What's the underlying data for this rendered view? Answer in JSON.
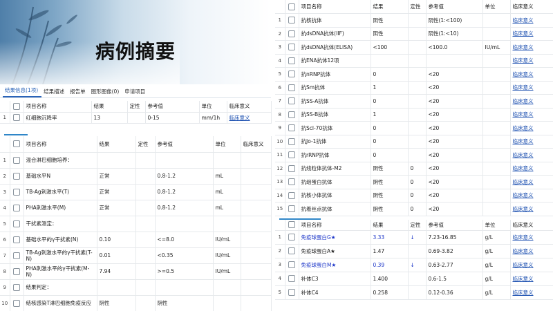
{
  "banner": {
    "title": "病例摘要"
  },
  "tabs": [
    "结果信息(1项)",
    "结果描述",
    "报告单",
    "图形图像(0)",
    "申请项目"
  ],
  "table1": {
    "headers": [
      "项目名称",
      "结果",
      "定性",
      "参考值",
      "单位",
      "临床意义"
    ],
    "rows": [
      {
        "num": "1",
        "name": "红细胞沉降率",
        "result": "13",
        "qual": "",
        "ref": "0-15",
        "unit": "mm/1h",
        "meaning": "临床意义"
      }
    ]
  },
  "table2": {
    "headers": [
      "项目名称",
      "结果",
      "定性",
      "参考值",
      "单位",
      "临床意义"
    ],
    "rows": [
      {
        "num": "1",
        "name": "混合淋巴细胞培养：",
        "result": "",
        "qual": "",
        "ref": "",
        "unit": "",
        "meaning": ""
      },
      {
        "num": "2",
        "name": "基础水平N",
        "result": "正常",
        "qual": "",
        "ref": "0.8-1.2",
        "unit": "mL",
        "meaning": ""
      },
      {
        "num": "3",
        "name": "TB-Ag刺激水平(T)",
        "result": "正常",
        "qual": "",
        "ref": "0.8-1.2",
        "unit": "mL",
        "meaning": ""
      },
      {
        "num": "4",
        "name": "PHA刺激水平(M)",
        "result": "正常",
        "qual": "",
        "ref": "0.8-1.2",
        "unit": "mL",
        "meaning": ""
      },
      {
        "num": "5",
        "name": "干扰素测定：",
        "result": "",
        "qual": "",
        "ref": "",
        "unit": "",
        "meaning": ""
      },
      {
        "num": "6",
        "name": "基础水平的γ干扰素(N)",
        "result": "0.10",
        "qual": "",
        "ref": "<=8.0",
        "unit": "IU/mL",
        "meaning": ""
      },
      {
        "num": "7",
        "name": "TB-Ag刺激水平的γ干扰素(T-N)",
        "result": "0.01",
        "qual": "",
        "ref": "<0.35",
        "unit": "IU/mL",
        "meaning": ""
      },
      {
        "num": "8",
        "name": "PHA刺激水平的γ干扰素(M-N)",
        "result": "7.94",
        "qual": "",
        "ref": ">=0.5",
        "unit": "IU/mL",
        "meaning": ""
      },
      {
        "num": "9",
        "name": "结果判定：",
        "result": "",
        "qual": "",
        "ref": "",
        "unit": "",
        "meaning": ""
      },
      {
        "num": "10",
        "name": "结核感染T淋巴细胞免疫反应",
        "result": "阴性",
        "qual": "",
        "ref": "阴性",
        "unit": "",
        "meaning": ""
      }
    ]
  },
  "table3": {
    "headers": [
      "项目名称",
      "结果",
      "定性",
      "参考值",
      "单位",
      "临床意义"
    ],
    "rows": [
      {
        "num": "1",
        "name": "抗核抗体",
        "result": "阴性",
        "qual": "",
        "ref": "阴性(1:<100)",
        "unit": "",
        "meaning": "临床意义"
      },
      {
        "num": "2",
        "name": "抗dsDNA抗体(IIF)",
        "result": "阴性",
        "qual": "",
        "ref": "阴性(1:<10)",
        "unit": "",
        "meaning": "临床意义"
      },
      {
        "num": "3",
        "name": "抗dsDNA抗体(ELISA)",
        "result": "<100",
        "qual": "",
        "ref": "<100.0",
        "unit": "IU/mL",
        "meaning": "临床意义"
      },
      {
        "num": "4",
        "name": "抗ENA抗体12项",
        "result": "",
        "qual": "",
        "ref": "",
        "unit": "",
        "meaning": "临床意义"
      },
      {
        "num": "5",
        "name": "抗nRNP抗体",
        "result": "0",
        "qual": "",
        "ref": "<20",
        "unit": "",
        "meaning": "临床意义"
      },
      {
        "num": "6",
        "name": "抗Sm抗体",
        "result": "1",
        "qual": "",
        "ref": "<20",
        "unit": "",
        "meaning": "临床意义"
      },
      {
        "num": "7",
        "name": "抗SS-A抗体",
        "result": "0",
        "qual": "",
        "ref": "<20",
        "unit": "",
        "meaning": "临床意义"
      },
      {
        "num": "8",
        "name": "抗SS-B抗体",
        "result": "1",
        "qual": "",
        "ref": "<20",
        "unit": "",
        "meaning": "临床意义"
      },
      {
        "num": "9",
        "name": "抗Scl-70抗体",
        "result": "0",
        "qual": "",
        "ref": "<20",
        "unit": "",
        "meaning": "临床意义"
      },
      {
        "num": "10",
        "name": "抗Jo-1抗体",
        "result": "0",
        "qual": "",
        "ref": "<20",
        "unit": "",
        "meaning": "临床意义"
      },
      {
        "num": "11",
        "name": "抗rRNP抗体",
        "result": "0",
        "qual": "",
        "ref": "<20",
        "unit": "",
        "meaning": "临床意义"
      },
      {
        "num": "12",
        "name": "抗线粒体抗体-M2",
        "result": "阴性",
        "qual": "0",
        "ref": "<20",
        "unit": "",
        "meaning": "临床意义"
      },
      {
        "num": "13",
        "name": "抗组蛋白抗体",
        "result": "阴性",
        "qual": "0",
        "ref": "<20",
        "unit": "",
        "meaning": "临床意义"
      },
      {
        "num": "14",
        "name": "抗核小体抗体",
        "result": "阴性",
        "qual": "0",
        "ref": "<20",
        "unit": "",
        "meaning": "临床意义"
      },
      {
        "num": "15",
        "name": "抗着丝点抗体",
        "result": "阴性",
        "qual": "0",
        "ref": "<20",
        "unit": "",
        "meaning": "临床意义"
      }
    ]
  },
  "table4": {
    "headers": [
      "项目名称",
      "结果",
      "定性",
      "参考值",
      "单位",
      "临床意义"
    ],
    "rows": [
      {
        "num": "1",
        "name": "免疫球蛋白G★",
        "result": "3.33",
        "qual": "↓",
        "ref": "7.23-16.85",
        "unit": "g/L",
        "meaning": "临床意义",
        "abnormal": true
      },
      {
        "num": "2",
        "name": "免疫球蛋白A★",
        "result": "1.47",
        "qual": "",
        "ref": "0.69-3.82",
        "unit": "g/L",
        "meaning": "临床意义",
        "abnormal": false
      },
      {
        "num": "3",
        "name": "免疫球蛋白M★",
        "result": "0.39",
        "qual": "↓",
        "ref": "0.63-2.77",
        "unit": "g/L",
        "meaning": "临床意义",
        "abnormal": true
      },
      {
        "num": "4",
        "name": "补体C3",
        "result": "1.400",
        "qual": "",
        "ref": "0.6-1.5",
        "unit": "g/L",
        "meaning": "临床意义",
        "abnormal": false
      },
      {
        "num": "5",
        "name": "补体C4",
        "result": "0.258",
        "qual": "",
        "ref": "0.12-0.36",
        "unit": "g/L",
        "meaning": "临床意义",
        "abnormal": false
      }
    ]
  },
  "colors": {
    "link": "#1b4fb0",
    "abnormal": "#1b35c8",
    "tab_active": "#2a63b8",
    "accent": "#2f86c8"
  }
}
